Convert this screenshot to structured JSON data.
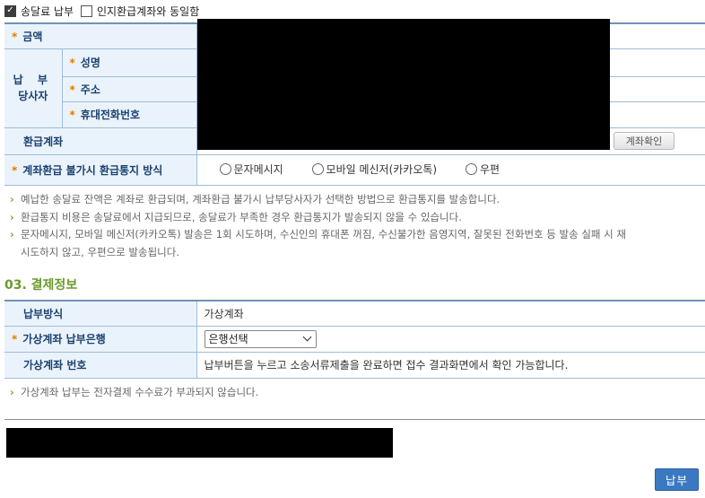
{
  "top": {
    "checkbox1_label": "송달료 납부",
    "checkbox2_label": "인지환급계좌와 동일함"
  },
  "refund": {
    "amount_label": "금액",
    "payer_label_line1": "납 부",
    "payer_label_line2": "당사자",
    "name_label": "성명",
    "address_label": "주소",
    "phone_label": "휴대전화번호",
    "account_label": "환급계좌",
    "account_confirm_button": "계좌확인",
    "notify_label": "계좌환급 불가시 환급통지 방식",
    "notify_options": [
      "문자메시지",
      "모바일 메신저(카카오톡)",
      "우편"
    ]
  },
  "notes": [
    "예납한 송달료 잔액은 계좌로 환급되며, 계좌환급 불가시 납부당사자가 선택한 방법으로 환급통지를 발송합니다.",
    "환급통지 비용은 송달료에서 지급되므로, 송달료가 부족한 경우 환급통지가 발송되지 않을 수 있습니다.",
    "문자메시지, 모바일 메신저(카카오톡) 발송은 1회 시도하며, 수신인의 휴대폰 꺼짐, 수신불가한 음영지역, 잘못된 전화번호 등 발송 실패 시 재",
    "시도하지 않고, 우편으로 발송됩니다."
  ],
  "payment": {
    "section_title": "03. 결제정보",
    "method_label": "납부방식",
    "method_value": "가상계좌",
    "bank_label": "가상계좌 납부은행",
    "bank_select_value": "은행선택",
    "account_no_label": "가상계좌 번호",
    "account_no_value": "납부버튼을 누르고 소송서류제출을 완료하면 접수 결과화면에서 확인 가능합니다.",
    "note": "가상계좌 납부는 전자결제 수수료가 부과되지 않습니다."
  },
  "footer": {
    "pay_button": "납부"
  },
  "colors": {
    "label_bg": "#eaf3fb",
    "label_text": "#1b4170",
    "required_star": "#e07b00",
    "section_title": "#6a9a2b",
    "pay_button": "#3a79c2"
  }
}
